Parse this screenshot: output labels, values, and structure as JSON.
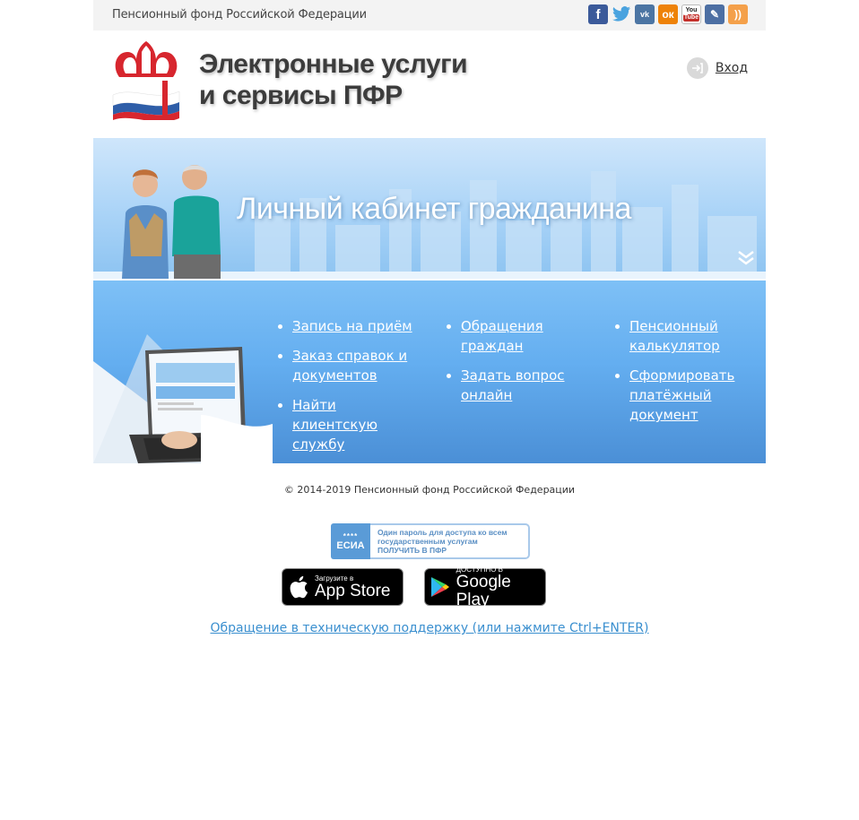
{
  "topbar": {
    "org_name": "Пенсионный фонд Российской Федерации",
    "social": [
      "facebook-icon",
      "twitter-icon",
      "vkontakte-icon",
      "odnoklassniki-icon",
      "youtube-icon",
      "livejournal-icon",
      "rss-icon"
    ],
    "social_text": {
      "fb": "f",
      "vk": "vk",
      "ok": "ок",
      "yt_top": "You",
      "yt_bottom": "Tube",
      "lj": "✎",
      "rss": "))"
    }
  },
  "header": {
    "title_line1": "Электронные услуги",
    "title_line2": "и сервисы ПФР",
    "login_label": "Вход"
  },
  "banner": {
    "title": "Личный кабинет гражданина"
  },
  "services": {
    "col1": [
      "Запись на приём",
      "Заказ справок и документов",
      "Найти клиентскую службу"
    ],
    "col2": [
      "Обращения граждан",
      "Задать вопрос онлайн"
    ],
    "col3": [
      "Пенсионный калькулятор",
      "Сформировать платёжный документ"
    ]
  },
  "footer": {
    "copyright": "© 2014-2019 Пенсионный фонд Российской Федерации",
    "esia": {
      "badge": "ЕСИА",
      "stars": "****",
      "line1": "Один пароль для доступа ко всем",
      "line2": "государственным услугам",
      "line3": "ПОЛУЧИТЬ В ПФР"
    },
    "app_store": {
      "small": "Загрузите в",
      "big": "App Store"
    },
    "google_play": {
      "small": "ДОСТУПНО В",
      "big": "Google Play"
    },
    "support_link": "Обращение в техническую поддержку (или нажмите Ctrl+ENTER)"
  },
  "colors": {
    "banner": "#a9d3f7",
    "services": "#64aef0",
    "link": "#3a8fcf"
  }
}
